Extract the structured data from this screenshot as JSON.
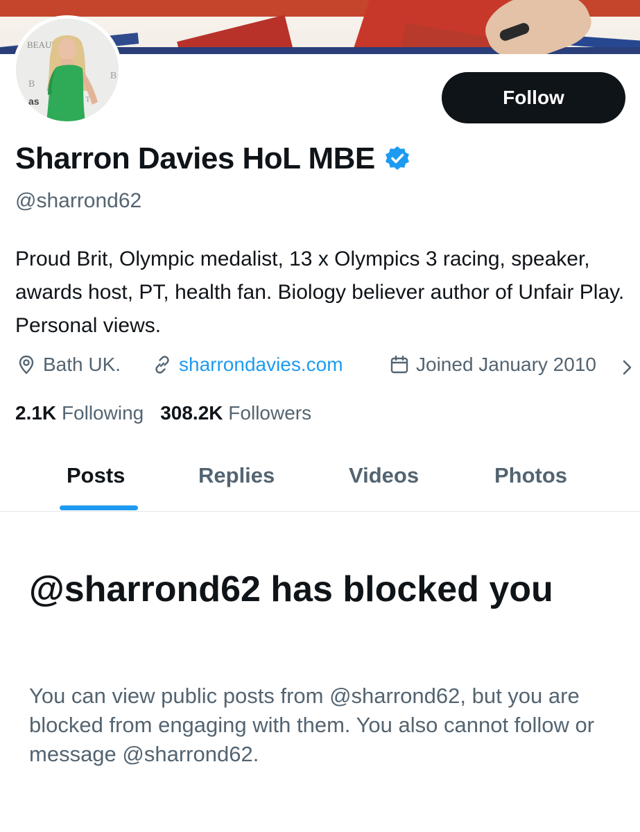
{
  "profile": {
    "display_name": "Sharron Davies HoL MBE",
    "handle": "@sharrond62",
    "bio": "Proud Brit, Olympic medalist, 13 x Olympics 3 racing, speaker, awards host, PT, health fan. Biology believer author of Unfair Play. Personal views.",
    "location": "Bath UK.",
    "website": "sharrondavies.com",
    "joined": "Joined January 2010",
    "following_count": "2.1K",
    "following_label": "Following",
    "followers_count": "308.2K",
    "followers_label": "Followers",
    "verified_icon": "verified-badge-icon",
    "avatar_backdrop_text": "BEAUTY AWARDS"
  },
  "actions": {
    "follow_label": "Follow"
  },
  "tabs": [
    {
      "label": "Posts",
      "active": true
    },
    {
      "label": "Replies",
      "active": false
    },
    {
      "label": "Videos",
      "active": false
    },
    {
      "label": "Photos",
      "active": false
    }
  ],
  "blocked": {
    "title": "@sharrond62 has blocked you",
    "description": "You can view public posts from @sharrond62, but you are blocked from engaging with them. You also cannot follow or message @sharrond62."
  },
  "colors": {
    "accent": "#1d9bf0",
    "text_primary": "#0f1419",
    "text_secondary": "#536471",
    "button_bg": "#0f1419"
  },
  "icons": {
    "location": "location-pin-icon",
    "website": "link-icon",
    "joined": "calendar-icon",
    "more": "chevron-right-icon"
  }
}
